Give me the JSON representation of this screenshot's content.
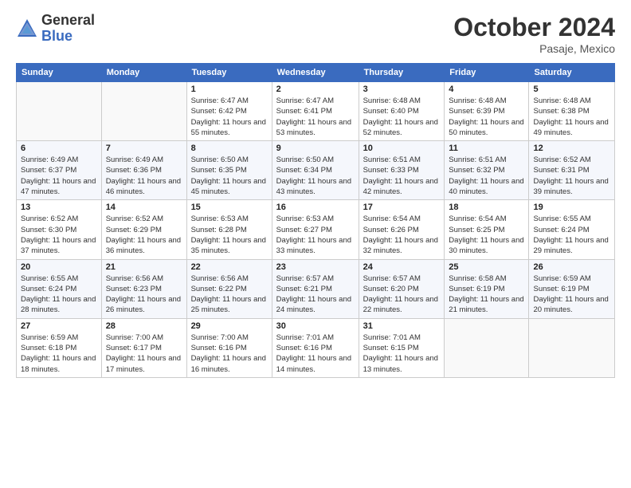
{
  "logo": {
    "general": "General",
    "blue": "Blue"
  },
  "title": "October 2024",
  "location": "Pasaje, Mexico",
  "days_of_week": [
    "Sunday",
    "Monday",
    "Tuesday",
    "Wednesday",
    "Thursday",
    "Friday",
    "Saturday"
  ],
  "weeks": [
    [
      {
        "day": "",
        "info": ""
      },
      {
        "day": "",
        "info": ""
      },
      {
        "day": "1",
        "info": "Sunrise: 6:47 AM\nSunset: 6:42 PM\nDaylight: 11 hours and 55 minutes."
      },
      {
        "day": "2",
        "info": "Sunrise: 6:47 AM\nSunset: 6:41 PM\nDaylight: 11 hours and 53 minutes."
      },
      {
        "day": "3",
        "info": "Sunrise: 6:48 AM\nSunset: 6:40 PM\nDaylight: 11 hours and 52 minutes."
      },
      {
        "day": "4",
        "info": "Sunrise: 6:48 AM\nSunset: 6:39 PM\nDaylight: 11 hours and 50 minutes."
      },
      {
        "day": "5",
        "info": "Sunrise: 6:48 AM\nSunset: 6:38 PM\nDaylight: 11 hours and 49 minutes."
      }
    ],
    [
      {
        "day": "6",
        "info": "Sunrise: 6:49 AM\nSunset: 6:37 PM\nDaylight: 11 hours and 47 minutes."
      },
      {
        "day": "7",
        "info": "Sunrise: 6:49 AM\nSunset: 6:36 PM\nDaylight: 11 hours and 46 minutes."
      },
      {
        "day": "8",
        "info": "Sunrise: 6:50 AM\nSunset: 6:35 PM\nDaylight: 11 hours and 45 minutes."
      },
      {
        "day": "9",
        "info": "Sunrise: 6:50 AM\nSunset: 6:34 PM\nDaylight: 11 hours and 43 minutes."
      },
      {
        "day": "10",
        "info": "Sunrise: 6:51 AM\nSunset: 6:33 PM\nDaylight: 11 hours and 42 minutes."
      },
      {
        "day": "11",
        "info": "Sunrise: 6:51 AM\nSunset: 6:32 PM\nDaylight: 11 hours and 40 minutes."
      },
      {
        "day": "12",
        "info": "Sunrise: 6:52 AM\nSunset: 6:31 PM\nDaylight: 11 hours and 39 minutes."
      }
    ],
    [
      {
        "day": "13",
        "info": "Sunrise: 6:52 AM\nSunset: 6:30 PM\nDaylight: 11 hours and 37 minutes."
      },
      {
        "day": "14",
        "info": "Sunrise: 6:52 AM\nSunset: 6:29 PM\nDaylight: 11 hours and 36 minutes."
      },
      {
        "day": "15",
        "info": "Sunrise: 6:53 AM\nSunset: 6:28 PM\nDaylight: 11 hours and 35 minutes."
      },
      {
        "day": "16",
        "info": "Sunrise: 6:53 AM\nSunset: 6:27 PM\nDaylight: 11 hours and 33 minutes."
      },
      {
        "day": "17",
        "info": "Sunrise: 6:54 AM\nSunset: 6:26 PM\nDaylight: 11 hours and 32 minutes."
      },
      {
        "day": "18",
        "info": "Sunrise: 6:54 AM\nSunset: 6:25 PM\nDaylight: 11 hours and 30 minutes."
      },
      {
        "day": "19",
        "info": "Sunrise: 6:55 AM\nSunset: 6:24 PM\nDaylight: 11 hours and 29 minutes."
      }
    ],
    [
      {
        "day": "20",
        "info": "Sunrise: 6:55 AM\nSunset: 6:24 PM\nDaylight: 11 hours and 28 minutes."
      },
      {
        "day": "21",
        "info": "Sunrise: 6:56 AM\nSunset: 6:23 PM\nDaylight: 11 hours and 26 minutes."
      },
      {
        "day": "22",
        "info": "Sunrise: 6:56 AM\nSunset: 6:22 PM\nDaylight: 11 hours and 25 minutes."
      },
      {
        "day": "23",
        "info": "Sunrise: 6:57 AM\nSunset: 6:21 PM\nDaylight: 11 hours and 24 minutes."
      },
      {
        "day": "24",
        "info": "Sunrise: 6:57 AM\nSunset: 6:20 PM\nDaylight: 11 hours and 22 minutes."
      },
      {
        "day": "25",
        "info": "Sunrise: 6:58 AM\nSunset: 6:19 PM\nDaylight: 11 hours and 21 minutes."
      },
      {
        "day": "26",
        "info": "Sunrise: 6:59 AM\nSunset: 6:19 PM\nDaylight: 11 hours and 20 minutes."
      }
    ],
    [
      {
        "day": "27",
        "info": "Sunrise: 6:59 AM\nSunset: 6:18 PM\nDaylight: 11 hours and 18 minutes."
      },
      {
        "day": "28",
        "info": "Sunrise: 7:00 AM\nSunset: 6:17 PM\nDaylight: 11 hours and 17 minutes."
      },
      {
        "day": "29",
        "info": "Sunrise: 7:00 AM\nSunset: 6:16 PM\nDaylight: 11 hours and 16 minutes."
      },
      {
        "day": "30",
        "info": "Sunrise: 7:01 AM\nSunset: 6:16 PM\nDaylight: 11 hours and 14 minutes."
      },
      {
        "day": "31",
        "info": "Sunrise: 7:01 AM\nSunset: 6:15 PM\nDaylight: 11 hours and 13 minutes."
      },
      {
        "day": "",
        "info": ""
      },
      {
        "day": "",
        "info": ""
      }
    ]
  ]
}
